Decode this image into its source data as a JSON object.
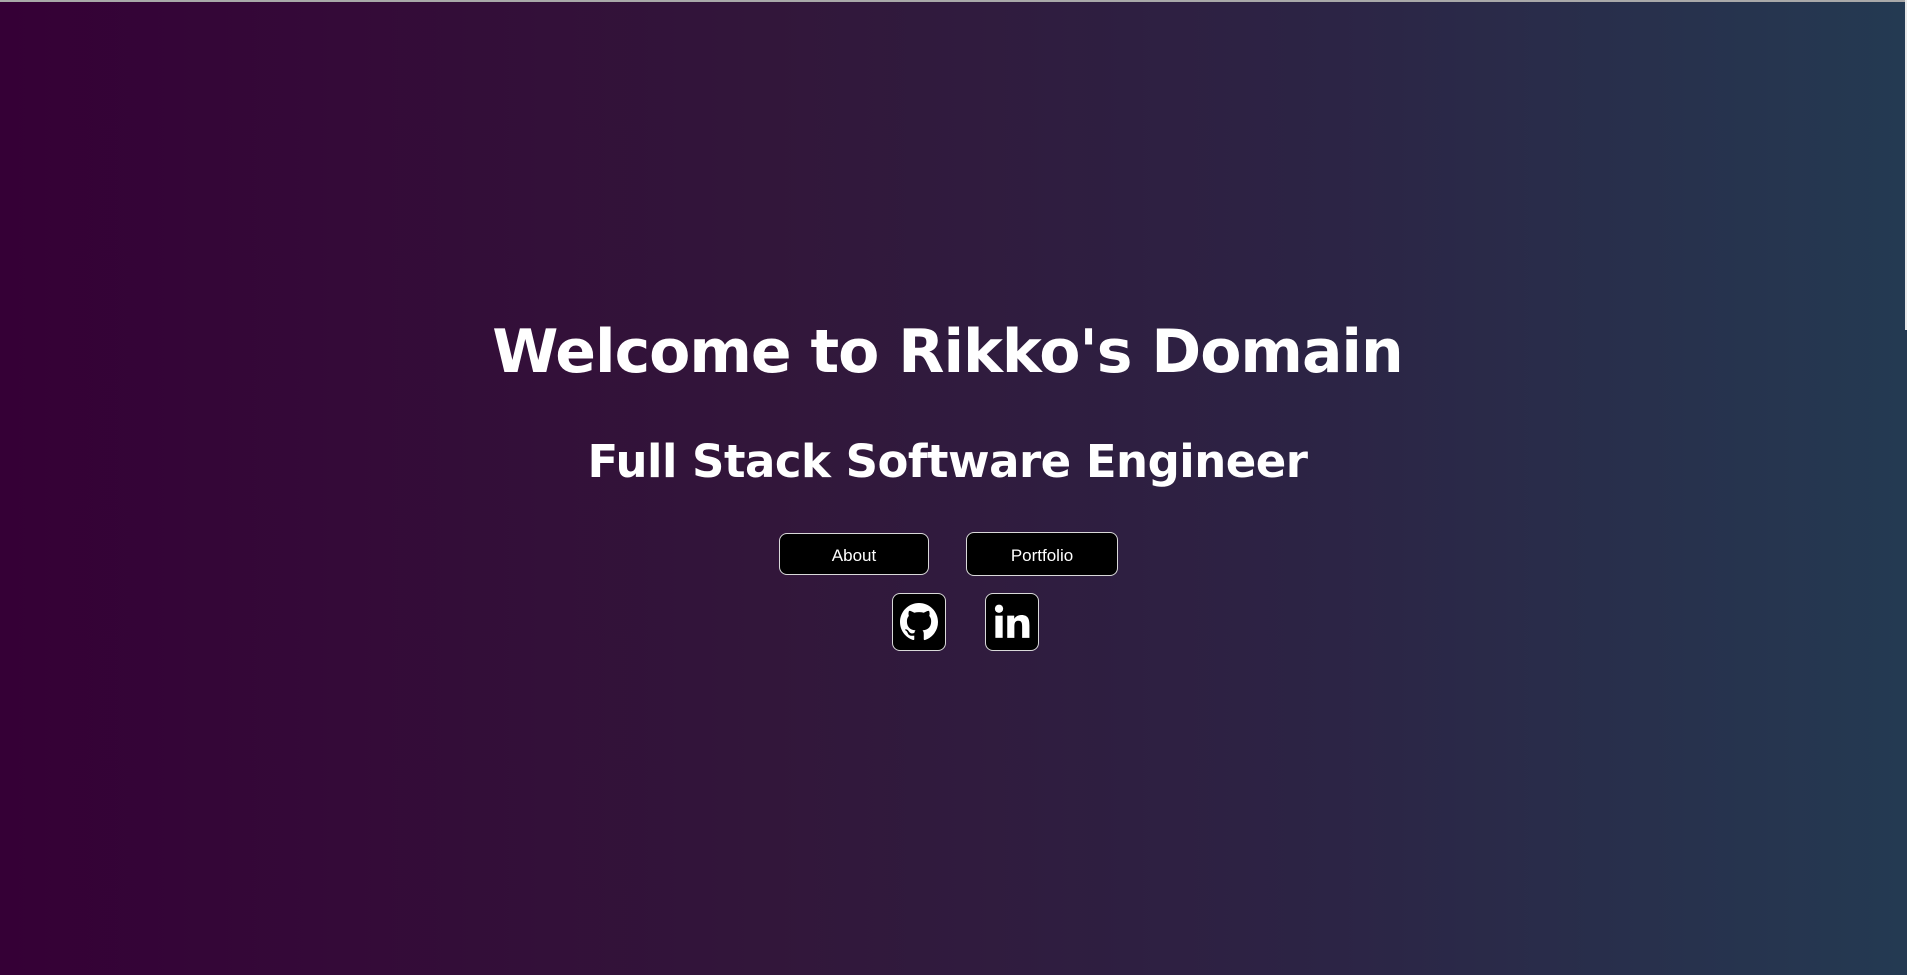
{
  "hero": {
    "title": "Welcome to Rikko's Domain",
    "subtitle": "Full Stack Software Engineer"
  },
  "nav": {
    "about_label": "About",
    "portfolio_label": "Portfolio"
  },
  "social": {
    "github_icon": "github-icon",
    "linkedin_icon": "linkedin-icon"
  },
  "colors": {
    "gradient_start": "#350036",
    "gradient_end": "#243a52",
    "button_bg": "#000000",
    "text": "#ffffff"
  }
}
